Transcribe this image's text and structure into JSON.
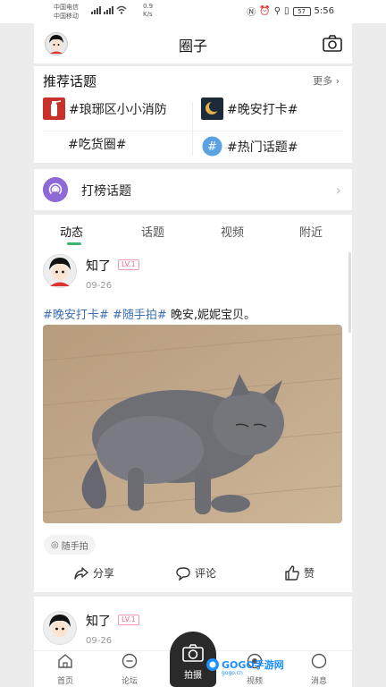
{
  "status_bar": {
    "carrier1": "中国电信",
    "carrier2": "中国移动",
    "speed": "0.9",
    "speed_unit": "K/s",
    "battery": "57",
    "time": "5:56"
  },
  "header": {
    "title": "圈子"
  },
  "topics": {
    "title": "推荐话题",
    "more": "更多",
    "items": [
      {
        "label": "#琅琊区小小消防"
      },
      {
        "label": "#晚安打卡#"
      },
      {
        "label": "#吃货圈#"
      },
      {
        "label": "#热门话题#"
      }
    ]
  },
  "rank": {
    "label": "打榜话题"
  },
  "tabs": [
    "动态",
    "话题",
    "视频",
    "附近"
  ],
  "post": {
    "username": "知了",
    "level": "LV.1",
    "date": "09-26",
    "tag1": "#晚安打卡#",
    "tag2": "#随手拍#",
    "text": " 晚安,妮妮宝贝。",
    "chip": "随手拍",
    "share": "分享",
    "comment": "评论",
    "like": "赞"
  },
  "post2": {
    "username": "知了",
    "level": "LV.1",
    "date": "09-26"
  },
  "bottom_nav": {
    "home": "首页",
    "forum": "论坛",
    "shoot": "拍摄",
    "fourth": "视频",
    "messages": "消息"
  },
  "watermark": {
    "brand": "GOGO手游网",
    "domain": "gogo.cn"
  },
  "colors": {
    "accent_green": "#3cb371",
    "tag_blue": "#3b6fb0",
    "level_pink": "#e96c8d",
    "rank_purple": "#8e6ad6"
  }
}
